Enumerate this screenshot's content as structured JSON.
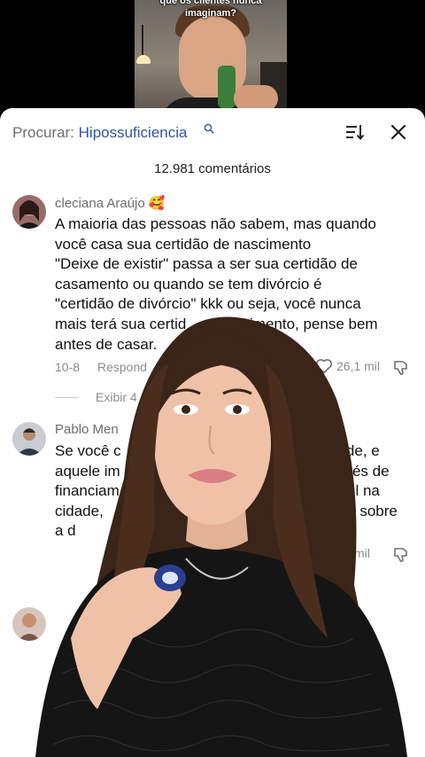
{
  "video": {
    "caption_line1": "que os clientes nunca",
    "caption_line2": "imaginam?"
  },
  "search": {
    "prefix": "Procurar: ",
    "term": "Hipossuficiencia"
  },
  "comments_count": "12.981 comentários",
  "comments": [
    {
      "author": "cleciana Araújo 🥰",
      "lines": [
        "A maioria das pessoas não sabem, mas quando",
        "você casa sua certidão de nascimento",
        "\"Deixe de existir\" passa a ser sua certidão de",
        "casamento ou quando se tem divórcio é",
        "\"certidão de divórcio\" kkk ou seja, você nunca",
        "mais terá sua certid",
        "antes de casar."
      ],
      "line6_tail": "imento, pense bem",
      "date": "10-8",
      "reply_label": "Respond",
      "likes": "26,1 mil",
      "view_replies": "Exibir 4"
    },
    {
      "author": "Pablo Men",
      "lines": [
        "Se você c",
        "aquele im",
        "financiam",
        "cidade,",
        "a d"
      ],
      "tails": [
        "dade, e",
        "avés de",
        "el na",
        "nto sobre",
        ""
      ],
      "likes_partial": "mil"
    }
  ],
  "colors": {
    "search_term": "#2f55a4",
    "muted_text": "#8c8c8c"
  }
}
